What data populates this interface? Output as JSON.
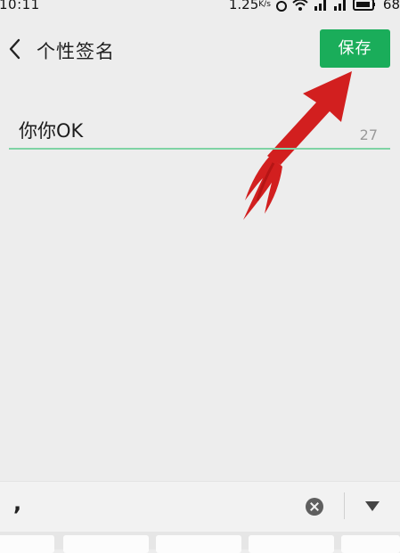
{
  "status_bar": {
    "time": "10:11",
    "speed": "1.25",
    "speed_unit": "K/s",
    "battery": "68"
  },
  "header": {
    "title": "个性签名",
    "save_label": "保存"
  },
  "signature": {
    "value": "你你OK",
    "remaining": "27"
  },
  "keyboard": {
    "preedit": ","
  },
  "colors": {
    "accent": "#1aad5a",
    "underline": "#7fd3a5",
    "background": "#ededed"
  }
}
